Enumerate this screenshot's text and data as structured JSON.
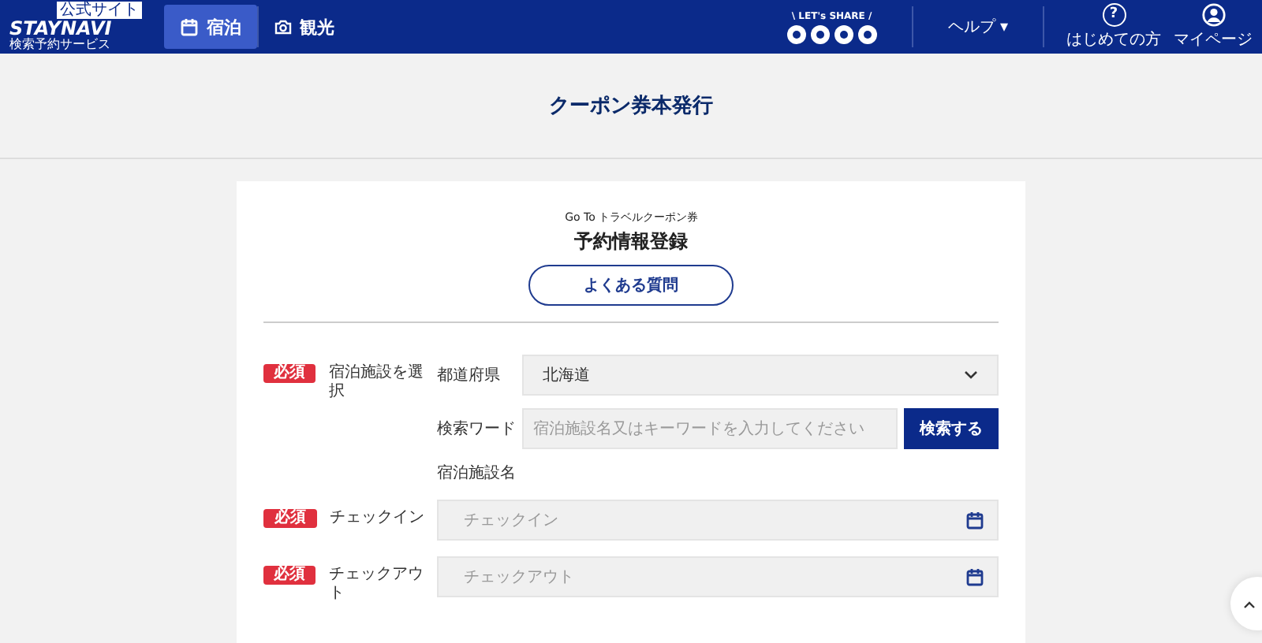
{
  "header": {
    "logo": {
      "badge": "公式サイト",
      "name": "STAYNAVI",
      "tagline": "検索予約サービス"
    },
    "nav": [
      {
        "label": "宿泊",
        "selected": true,
        "kind": "calendar"
      },
      {
        "label": "観光",
        "selected": false,
        "kind": "camera"
      }
    ],
    "share": {
      "label": "\\ LET's SHARE /"
    },
    "help": {
      "label": "ヘルプ ▾"
    },
    "links": [
      {
        "label": "はじめての方",
        "kind": "question",
        "glyph": "?"
      },
      {
        "label": "マイページ",
        "kind": "user"
      }
    ]
  },
  "page_title": "クーポン券本発行",
  "card": {
    "subtitle": "Go To トラベルクーポン券",
    "heading": "予約情報登録",
    "faq_button": "よくある質問",
    "sections": [
      {
        "badge": "必須",
        "label": "宿泊施設を選択",
        "kind": "facility",
        "prefecture_label": "都道府県",
        "prefecture_value": "北海道",
        "keyword_label": "検索ワード",
        "keyword_placeholder": "宿泊施設名又はキーワードを入力してください",
        "search_button": "検索する",
        "facility_name_label": "宿泊施設名"
      },
      {
        "badge": "必須",
        "label": "チェックイン",
        "kind": "date",
        "placeholder": "チェックイン"
      },
      {
        "badge": "必須",
        "label": "チェックアウト",
        "kind": "date",
        "placeholder": "チェックアウト"
      }
    ]
  }
}
